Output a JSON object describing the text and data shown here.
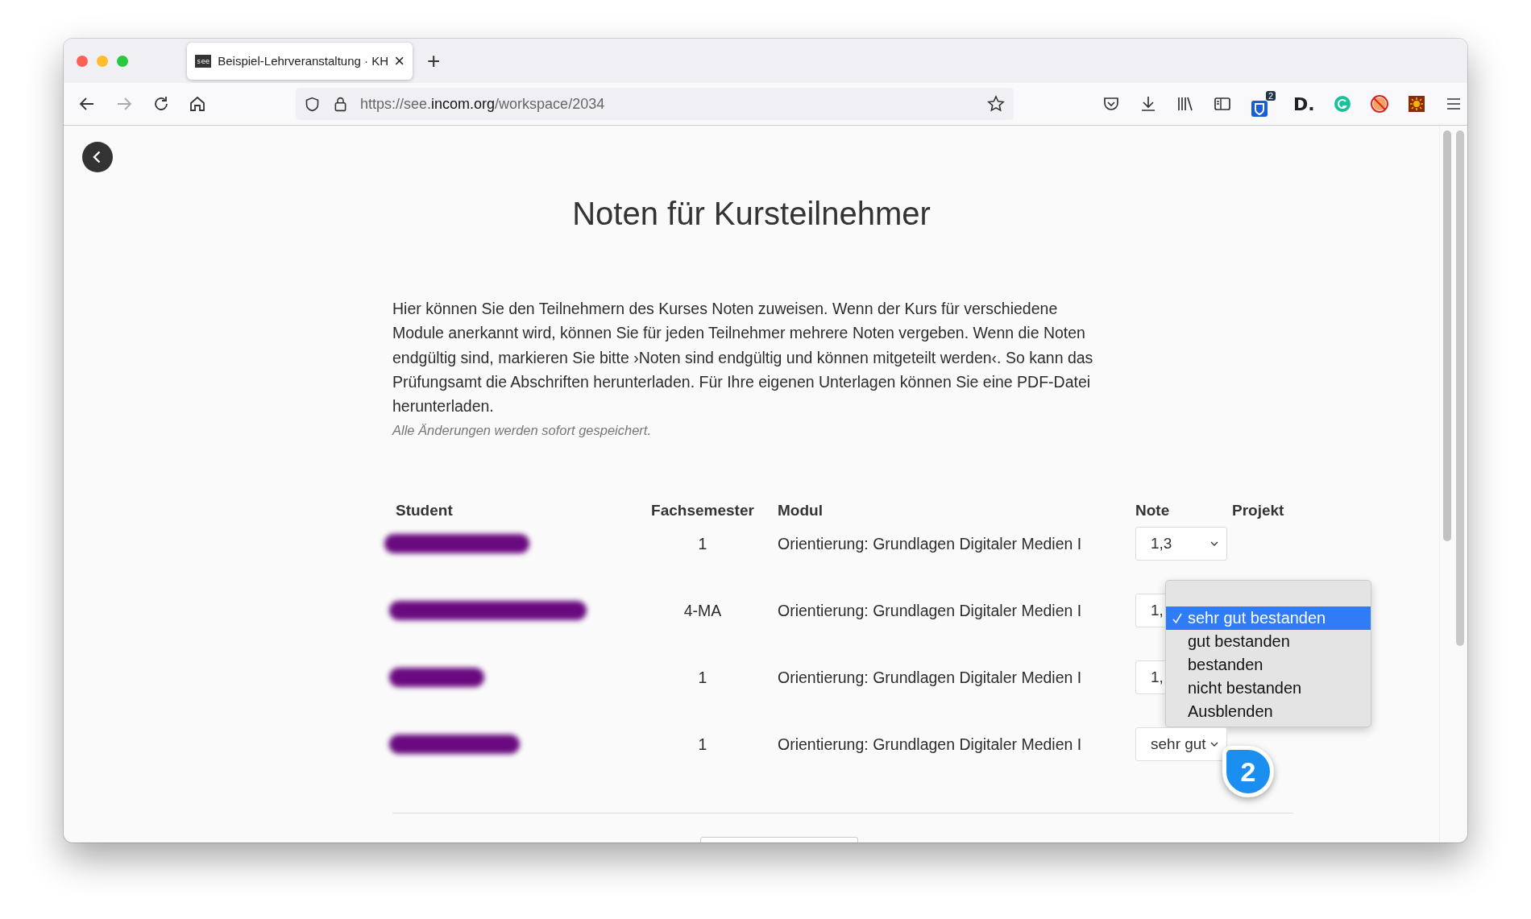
{
  "browser": {
    "tab": {
      "favicon": "see",
      "title": "Beispiel-Lehrveranstaltung · KH",
      "close": "×",
      "selected": true
    },
    "new_tab": "+",
    "url": {
      "prefix": "https://see.",
      "domain": "incom.org",
      "path": "/workspace/2034"
    },
    "extension_badge": "2",
    "extension_letter": "D."
  },
  "page": {
    "title": "Noten für Kursteilnehmer",
    "intro": "Hier können Sie den Teilnehmern des Kurses Noten zuweisen. Wenn der Kurs für verschiedene Module anerkannt wird, können Sie für jeden Teilnehmer mehrere Noten vergeben. Wenn die Noten endgültig sind, markieren Sie bitte ›Noten sind endgültig und können mitgeteilt werden‹. So kann das Prüfungsamt die Abschriften herunterladen. Für Ihre eigenen Unterlagen können Sie eine PDF-Datei herunterladen.",
    "note": "Alle Änderungen werden sofort gespeichert."
  },
  "table": {
    "columns": [
      "Student",
      "Fachsemester",
      "Modul",
      "Note",
      "Projekt"
    ],
    "rows": [
      {
        "semester": "1",
        "module": "Orientierung: Grundlagen Digitaler Medien I",
        "grade": "1,3",
        "partly_hidden": false
      },
      {
        "semester": "4-MA",
        "module": "Orientierung: Grundlagen Digitaler Medien I",
        "grade": "1,",
        "partly_hidden": true
      },
      {
        "semester": "1",
        "module": "Orientierung: Grundlagen Digitaler Medien I",
        "grade": "1,",
        "partly_hidden": true
      },
      {
        "semester": "1",
        "module": "Orientierung: Grundlagen Digitaler Medien I",
        "grade": "sehr gut",
        "partly_hidden": false
      }
    ]
  },
  "dropdown": {
    "options": [
      {
        "label": "sehr gut bestanden",
        "selected": true
      },
      {
        "label": "gut bestanden",
        "selected": false
      },
      {
        "label": "bestanden",
        "selected": false
      },
      {
        "label": "nicht bestanden",
        "selected": false
      },
      {
        "label": "Ausblenden",
        "selected": false
      }
    ]
  },
  "callout": "2"
}
